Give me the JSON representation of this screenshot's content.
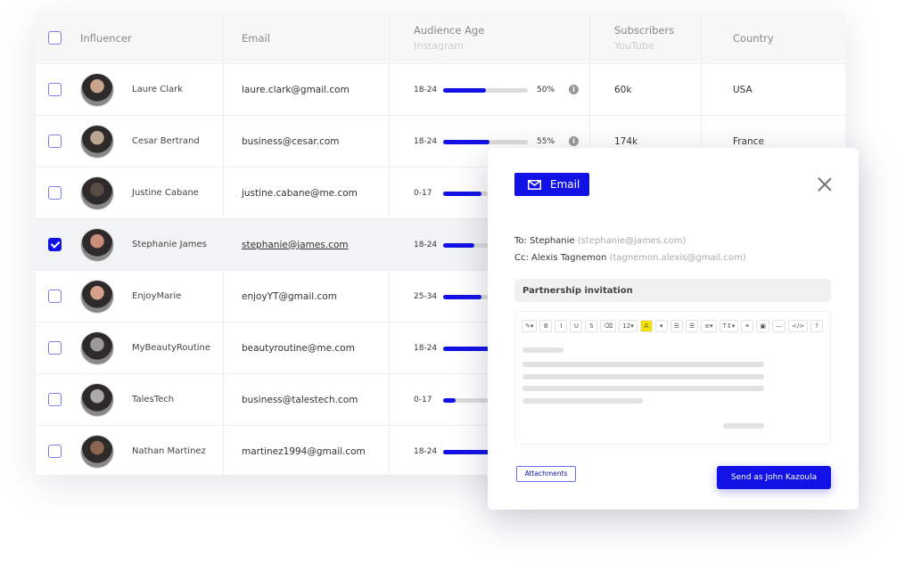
{
  "table": {
    "headers": {
      "influencer": "Influencer",
      "email": "Email",
      "audience_age": "Audience Age",
      "audience_age_sub": "Instagram",
      "subscribers": "Subscribers",
      "subscribers_sub": "YouTube",
      "country": "Country"
    },
    "rows": [
      {
        "name": "Laure Clark",
        "email": "laure.clark@gmail.com",
        "age": "18-24",
        "fill": 50,
        "pct": "50%",
        "subs": "60k",
        "country": "USA",
        "checked": false
      },
      {
        "name": "Cesar Bertrand",
        "email": "business@cesar.com",
        "age": "18-24",
        "fill": 55,
        "pct": "55%",
        "subs": "174k",
        "country": "France",
        "checked": false
      },
      {
        "name": "Justine Cabane",
        "email": "justine.cabane@me.com",
        "age": "0-17",
        "fill": 45,
        "checked": false
      },
      {
        "name": "Stephanie James",
        "email": "stephanie@james.com",
        "age": "18-24",
        "fill": 37,
        "checked": true
      },
      {
        "name": "EnjoyMarie",
        "email": "enjoyYT@gmail.com",
        "age": "25-34",
        "fill": 45,
        "checked": false
      },
      {
        "name": "MyBeautyRoutine",
        "email": "beautyroutine@me.com",
        "age": "18-24",
        "fill": 60,
        "checked": false
      },
      {
        "name": "TalesTech",
        "email": "business@talestech.com",
        "age": "0-17",
        "fill": 15,
        "checked": false
      },
      {
        "name": "Nathan Martinez",
        "email": "martinez1994@gmail.com",
        "age": "18-24",
        "fill": 60,
        "checked": false
      }
    ]
  },
  "modal": {
    "title": "Email",
    "to_label": "To: Stephanie",
    "to_email": "(stephanie@james.com)",
    "cc_label": "Cc: Alexis Tagnemon",
    "cc_email": "(tagnemon.alexis@gmail.com)",
    "subject": "Partnership invitation",
    "toolbar": [
      "✎▾",
      "B",
      "I",
      "U",
      "S",
      "⌫",
      "12▾",
      "A",
      "▾",
      "☰",
      "☰",
      "≡▾",
      "T↕▾",
      "⚭",
      "▣",
      "—",
      "</>",
      "?"
    ],
    "attachments": "Attachments",
    "send": "Send as John Kazoula"
  },
  "colors": {
    "accent": "#1212e6"
  }
}
